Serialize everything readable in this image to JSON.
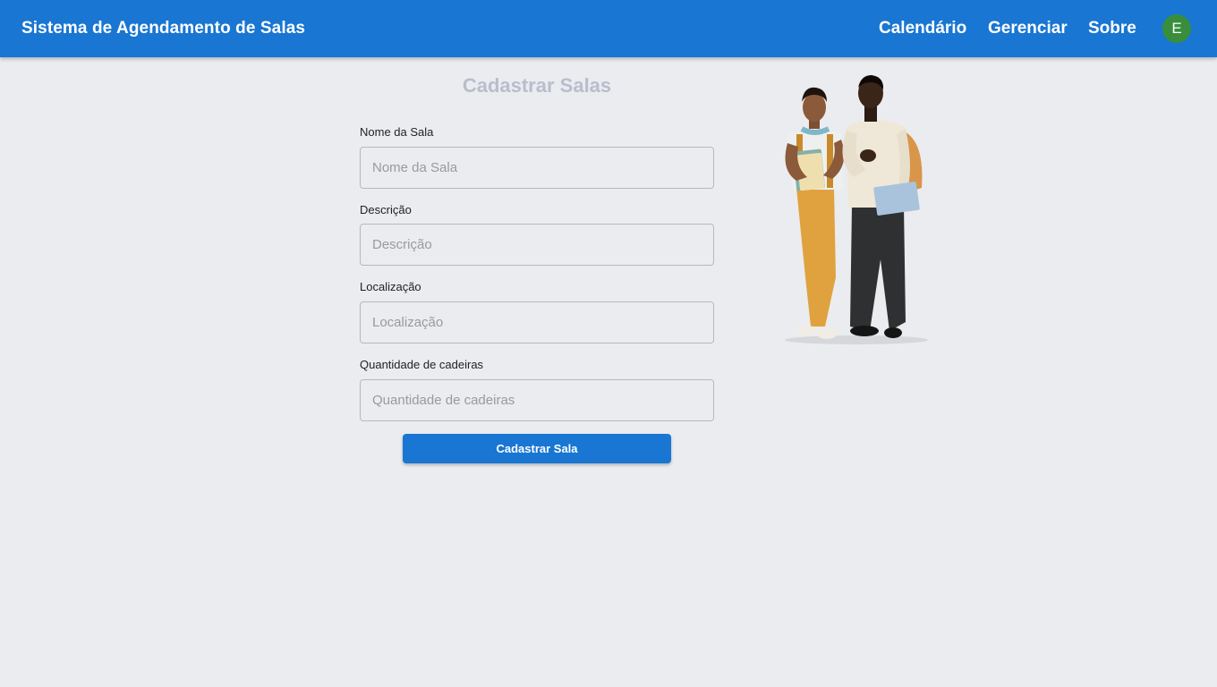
{
  "header": {
    "title": "Sistema de Agendamento de Salas",
    "nav": [
      "Calendário",
      "Gerenciar",
      "Sobre"
    ],
    "avatar_initial": "E"
  },
  "form": {
    "title": "Cadastrar Salas",
    "fields": [
      {
        "label": "Nome da Sala",
        "placeholder": "Nome da Sala",
        "value": ""
      },
      {
        "label": "Descrição",
        "placeholder": "Descrição",
        "value": ""
      },
      {
        "label": "Localização",
        "placeholder": "Localização",
        "value": ""
      },
      {
        "label": "Quantidade de cadeiras",
        "placeholder": "Quantidade de cadeiras",
        "value": ""
      }
    ],
    "submit_label": "Cadastrar Sala"
  },
  "colors": {
    "appbar": "#1976d2",
    "avatar": "#388e3c",
    "background": "#ebecef",
    "title": "#b9bdcc"
  }
}
